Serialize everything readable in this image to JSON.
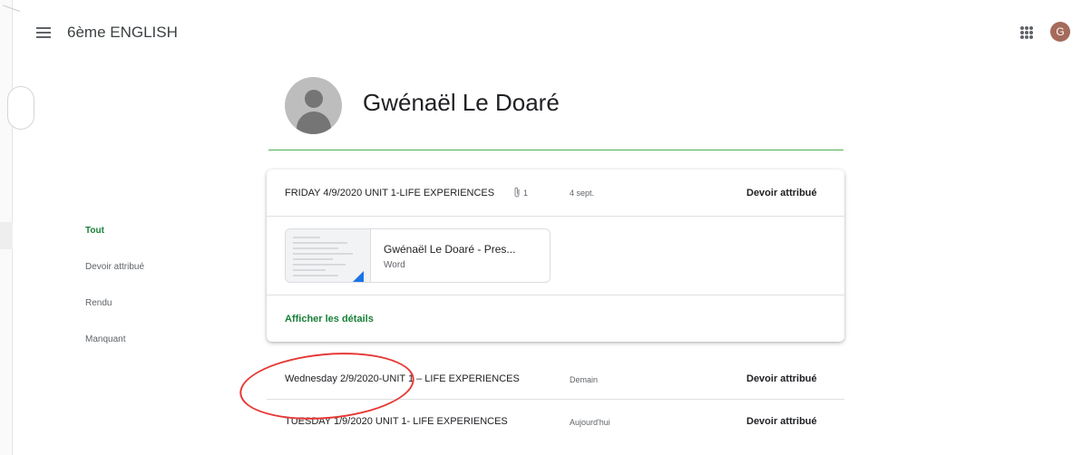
{
  "header": {
    "class_title": "6ème ENGLISH",
    "avatar_letter": "G"
  },
  "student": {
    "name": "Gwénaël Le Doaré"
  },
  "filters": [
    {
      "label": "Tout",
      "active": true
    },
    {
      "label": "Devoir attribué",
      "active": false
    },
    {
      "label": "Rendu",
      "active": false
    },
    {
      "label": "Manquant",
      "active": false
    }
  ],
  "assignments": [
    {
      "title": "FRIDAY 4/9/2020 UNIT 1-LIFE EXPERIENCES",
      "attachment_icon": "paperclip-icon",
      "attachment_count": "1",
      "date": "4 sept.",
      "status": "Devoir attribué",
      "expanded": true,
      "file": {
        "name": "Gwénaël Le Doaré - Pres...",
        "type": "Word"
      },
      "details_link": "Afficher les détails"
    },
    {
      "title": "Wednesday 2/9/2020-UNIT 1 – LIFE EXPERIENCES",
      "date": "Demain",
      "status": "Devoir attribué"
    },
    {
      "title": "TUESDAY 1/9/2020 UNIT 1- LIFE EXPERIENCES",
      "date": "Aujourd'hui",
      "status": "Devoir attribué"
    }
  ],
  "colors": {
    "accent_green": "#188038",
    "annotation_red": "#e53935",
    "word_blue": "#1a73e8"
  }
}
